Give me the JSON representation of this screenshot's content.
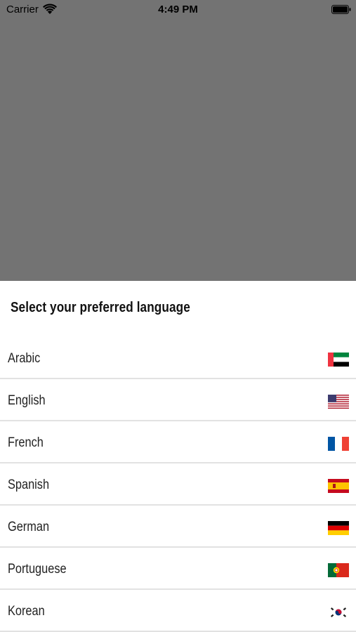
{
  "status_bar": {
    "carrier": "Carrier",
    "time": "4:49 PM"
  },
  "sheet": {
    "title": "Select your preferred language",
    "languages": [
      {
        "label": "Arabic",
        "flag": "uae-flag-icon"
      },
      {
        "label": "English",
        "flag": "us-flag-icon"
      },
      {
        "label": "French",
        "flag": "france-flag-icon"
      },
      {
        "label": "Spanish",
        "flag": "spain-flag-icon"
      },
      {
        "label": "German",
        "flag": "germany-flag-icon"
      },
      {
        "label": "Portuguese",
        "flag": "portugal-flag-icon"
      },
      {
        "label": "Korean",
        "flag": "korea-flag-icon"
      }
    ]
  }
}
